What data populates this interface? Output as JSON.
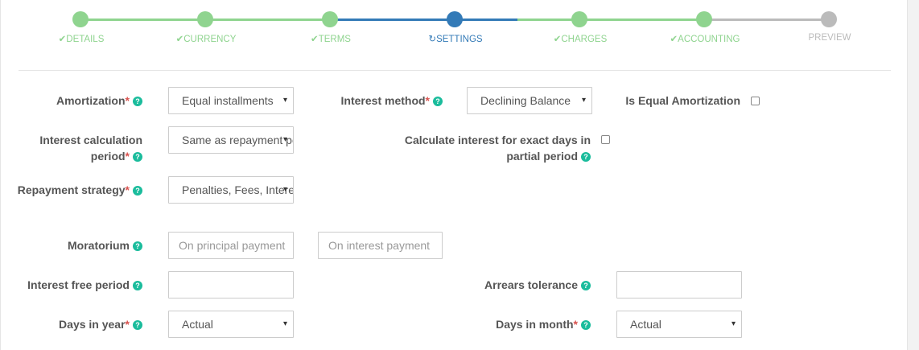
{
  "colors": {
    "done": "#5cb85c",
    "done_light": "#8fd48f",
    "active": "#337ab7",
    "pending": "#bbbbbb",
    "help": "#1abc9c",
    "required": "#d9534f"
  },
  "steps": [
    {
      "label": "DETAILS",
      "state": "done",
      "icon": "check-icon",
      "glyph": "✔"
    },
    {
      "label": "CURRENCY",
      "state": "done",
      "icon": "check-icon",
      "glyph": "✔"
    },
    {
      "label": "TERMS",
      "state": "done",
      "icon": "check-icon",
      "glyph": "✔"
    },
    {
      "label": "SETTINGS",
      "state": "active",
      "icon": "refresh-icon",
      "glyph": "↻"
    },
    {
      "label": "CHARGES",
      "state": "done",
      "icon": "check-icon",
      "glyph": "✔"
    },
    {
      "label": "ACCOUNTING",
      "state": "done",
      "icon": "check-icon",
      "glyph": "✔"
    },
    {
      "label": "PREVIEW",
      "state": "pending",
      "icon": "",
      "glyph": ""
    }
  ],
  "form": {
    "help_glyph": "?",
    "required_mark": "*",
    "caret": "▾",
    "amortization": {
      "label": "Amortization",
      "value": "Equal installments"
    },
    "interest_method": {
      "label": "Interest method",
      "value": "Declining Balance"
    },
    "equal_amortization": {
      "label": "Is Equal Amortization"
    },
    "interest_calc_period": {
      "label_line1": "Interest calculation",
      "label_line2": "period",
      "value": "Same as repayment period"
    },
    "exact_days": {
      "label_line1": "Calculate interest for exact days in",
      "label_line2": "partial period"
    },
    "repayment_strategy": {
      "label": "Repayment strategy",
      "value": "Penalties, Fees, Interest, Principal order"
    },
    "moratorium": {
      "label": "Moratorium",
      "principal_placeholder": "On principal payment",
      "interest_placeholder": "On interest payment"
    },
    "interest_free_period": {
      "label": "Interest free period",
      "value": ""
    },
    "arrears_tolerance": {
      "label": "Arrears tolerance",
      "value": ""
    },
    "days_in_year": {
      "label": "Days in year",
      "value": "Actual"
    },
    "days_in_month": {
      "label": "Days in month",
      "value": "Actual"
    }
  }
}
